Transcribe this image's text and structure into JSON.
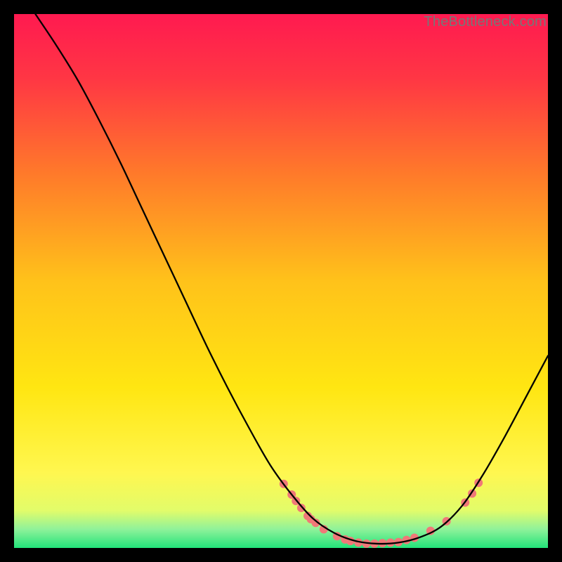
{
  "watermark": "TheBottleneck.com",
  "chart_data": {
    "type": "line",
    "title": "",
    "xlabel": "",
    "ylabel": "",
    "legend": false,
    "grid": false,
    "axes_visible": false,
    "xlim": [
      0,
      100
    ],
    "ylim": [
      0,
      100
    ],
    "gradient_stops": [
      {
        "offset": 0.0,
        "color": "#ff1a50"
      },
      {
        "offset": 0.12,
        "color": "#ff3644"
      },
      {
        "offset": 0.3,
        "color": "#ff7a2a"
      },
      {
        "offset": 0.5,
        "color": "#ffc21a"
      },
      {
        "offset": 0.7,
        "color": "#ffe612"
      },
      {
        "offset": 0.86,
        "color": "#fff750"
      },
      {
        "offset": 0.93,
        "color": "#e2fc6a"
      },
      {
        "offset": 0.965,
        "color": "#8ff29a"
      },
      {
        "offset": 1.0,
        "color": "#22e37a"
      }
    ],
    "curve": [
      {
        "x": 4.0,
        "y": 100.0
      },
      {
        "x": 8.0,
        "y": 94.0
      },
      {
        "x": 12.0,
        "y": 87.5
      },
      {
        "x": 16.0,
        "y": 80.0
      },
      {
        "x": 20.0,
        "y": 72.0
      },
      {
        "x": 24.0,
        "y": 63.5
      },
      {
        "x": 28.0,
        "y": 55.0
      },
      {
        "x": 32.0,
        "y": 46.5
      },
      {
        "x": 36.0,
        "y": 38.0
      },
      {
        "x": 40.0,
        "y": 30.0
      },
      {
        "x": 44.0,
        "y": 22.5
      },
      {
        "x": 48.0,
        "y": 15.5
      },
      {
        "x": 52.0,
        "y": 10.0
      },
      {
        "x": 56.0,
        "y": 5.5
      },
      {
        "x": 60.0,
        "y": 2.8
      },
      {
        "x": 64.0,
        "y": 1.3
      },
      {
        "x": 68.0,
        "y": 0.8
      },
      {
        "x": 72.0,
        "y": 1.0
      },
      {
        "x": 76.0,
        "y": 2.0
      },
      {
        "x": 80.0,
        "y": 4.0
      },
      {
        "x": 84.0,
        "y": 8.0
      },
      {
        "x": 88.0,
        "y": 14.0
      },
      {
        "x": 92.0,
        "y": 21.0
      },
      {
        "x": 96.0,
        "y": 28.5
      },
      {
        "x": 100.0,
        "y": 36.0
      }
    ],
    "scatter": [
      {
        "x": 50.5,
        "y": 12.0
      },
      {
        "x": 52.0,
        "y": 10.0
      },
      {
        "x": 52.8,
        "y": 8.8
      },
      {
        "x": 53.8,
        "y": 7.5
      },
      {
        "x": 55.0,
        "y": 6.0
      },
      {
        "x": 55.6,
        "y": 5.4
      },
      {
        "x": 56.5,
        "y": 4.7
      },
      {
        "x": 58.0,
        "y": 3.5
      },
      {
        "x": 60.5,
        "y": 2.2
      },
      {
        "x": 62.0,
        "y": 1.6
      },
      {
        "x": 63.0,
        "y": 1.3
      },
      {
        "x": 64.5,
        "y": 1.0
      },
      {
        "x": 66.0,
        "y": 0.8
      },
      {
        "x": 67.5,
        "y": 0.8
      },
      {
        "x": 69.0,
        "y": 0.9
      },
      {
        "x": 70.5,
        "y": 1.0
      },
      {
        "x": 72.0,
        "y": 1.1
      },
      {
        "x": 73.5,
        "y": 1.5
      },
      {
        "x": 75.0,
        "y": 1.9
      },
      {
        "x": 78.0,
        "y": 3.2
      },
      {
        "x": 81.0,
        "y": 5.0
      },
      {
        "x": 84.5,
        "y": 8.5
      },
      {
        "x": 85.8,
        "y": 10.2
      },
      {
        "x": 87.0,
        "y": 12.2
      }
    ],
    "scatter_color": "#f07878",
    "scatter_radius": 6,
    "curve_color": "#000000",
    "curve_width": 2.3
  }
}
